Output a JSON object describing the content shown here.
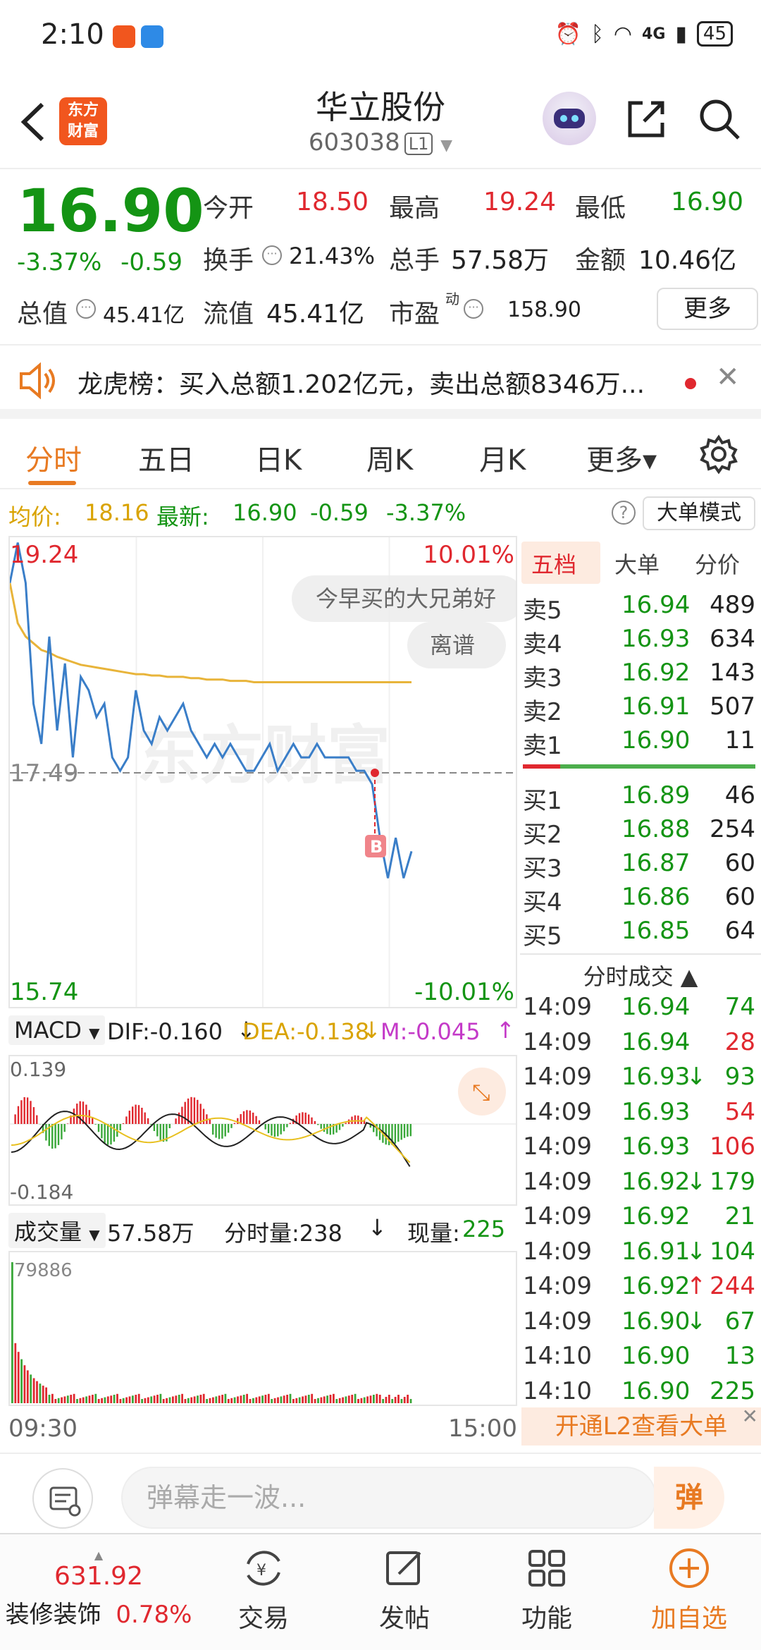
{
  "status_bar": {
    "time": "2:10",
    "battery": "45",
    "network": "4G"
  },
  "header": {
    "title": "华立股份",
    "code": "603038",
    "level": "L1"
  },
  "logo": {
    "line1": "东方",
    "line2": "财富"
  },
  "quote": {
    "price": "16.90",
    "change_pct": "-3.37%",
    "change_amt": "-0.59",
    "open_label": "今开",
    "open_value": "18.50",
    "high_label": "最高",
    "high_value": "19.24",
    "low_label": "最低",
    "low_value": "16.90",
    "turnover_rate_label": "换手",
    "turnover_rate_value": "21.43%",
    "volume_label": "总手",
    "volume_value": "57.58万",
    "amount_label": "金额",
    "amount_value": "10.46亿",
    "market_cap_label": "总值",
    "market_cap_value": "45.41亿",
    "float_cap_label": "流值",
    "float_cap_value": "45.41亿",
    "pe_label": "市盈",
    "pe_superscript": "动",
    "pe_value": "158.90",
    "more_button": "更多"
  },
  "banner": {
    "text": "龙虎榜：买入总额1.202亿元，卖出总额8346万..."
  },
  "tabs": [
    {
      "label": "分时",
      "active": true
    },
    {
      "label": "五日"
    },
    {
      "label": "日K"
    },
    {
      "label": "周K"
    },
    {
      "label": "月K"
    },
    {
      "label": "更多▾"
    }
  ],
  "avg_line": {
    "avg_label": "均价:",
    "avg_value": "18.16",
    "latest_label": "最新:",
    "latest_value": "16.90",
    "change_amt": "-0.59",
    "change_pct": "-3.37%",
    "mode_button": "大单模式"
  },
  "chart": {
    "high_label": "19.24",
    "low_label": "15.74",
    "up_pct": "10.01%",
    "down_pct": "-10.01%",
    "prev_close_label": "17.49",
    "watermark": "东方财富",
    "buy_marker": "B",
    "danmaku": [
      "今早买的大兄弟好",
      "离谱"
    ]
  },
  "chart_data": {
    "type": "line",
    "title": "",
    "ylim": [
      15.74,
      19.24
    ],
    "prev_close": 17.49,
    "series": [
      {
        "values": [
          18.9,
          19.2,
          18.9,
          18.0,
          17.7,
          18.5,
          17.8,
          18.3,
          17.6,
          18.2,
          18.1,
          17.9,
          18.0,
          17.6,
          17.5,
          17.6,
          18.1,
          17.8,
          17.7,
          17.9,
          17.8,
          17.9,
          18.0,
          17.8,
          17.7,
          17.6,
          17.7,
          17.6,
          17.7,
          17.6,
          17.5,
          17.5,
          17.6,
          17.7,
          17.5,
          17.6,
          17.7,
          17.6,
          17.6,
          17.7,
          17.6,
          17.6,
          17.6,
          17.6,
          17.5,
          17.5,
          17.4,
          17.0,
          16.7,
          17.0,
          16.7,
          16.9
        ]
      },
      {
        "name": "均价",
        "values": [
          18.9,
          18.6,
          18.5,
          18.45,
          18.4,
          18.38,
          18.35,
          18.33,
          18.31,
          18.29,
          18.28,
          18.27,
          18.26,
          18.25,
          18.24,
          18.23,
          18.22,
          18.22,
          18.21,
          18.21,
          18.2,
          18.2,
          18.2,
          18.19,
          18.19,
          18.18,
          18.18,
          18.18,
          18.17,
          18.17,
          18.17,
          18.16,
          18.16,
          18.16,
          18.16,
          18.16,
          18.16,
          18.16,
          18.16,
          18.16,
          18.16,
          18.16,
          18.16,
          18.16,
          18.16,
          18.16,
          18.16,
          18.16,
          18.16,
          18.16,
          18.16,
          18.16
        ]
      }
    ]
  },
  "macd": {
    "selector": "MACD",
    "dif": "DIF:-0.160",
    "dea": "DEA:-0.138",
    "m": "M:-0.045",
    "top_label": "0.139",
    "bottom_label": "-0.184"
  },
  "volume": {
    "selector": "成交量",
    "total": "57.58万",
    "minute_label": "分时量:238",
    "current_label": "现量:",
    "current_value": "225",
    "max_label": "79886"
  },
  "time_axis": {
    "start": "09:30",
    "end": "15:00"
  },
  "orderbook": {
    "tabs": [
      "五档",
      "大单",
      "分价"
    ],
    "asks": [
      {
        "label": "卖5",
        "price": "16.94",
        "vol": "489"
      },
      {
        "label": "卖4",
        "price": "16.93",
        "vol": "634"
      },
      {
        "label": "卖3",
        "price": "16.92",
        "vol": "143"
      },
      {
        "label": "卖2",
        "price": "16.91",
        "vol": "507"
      },
      {
        "label": "卖1",
        "price": "16.90",
        "vol": "11"
      }
    ],
    "bids": [
      {
        "label": "买1",
        "price": "16.89",
        "vol": "46"
      },
      {
        "label": "买2",
        "price": "16.88",
        "vol": "254"
      },
      {
        "label": "买3",
        "price": "16.87",
        "vol": "60"
      },
      {
        "label": "买4",
        "price": "16.86",
        "vol": "60"
      },
      {
        "label": "买5",
        "price": "16.85",
        "vol": "64"
      }
    ],
    "ticks_title": "分时成交 ▲",
    "ticks": [
      {
        "time": "14:09",
        "price": "16.94",
        "arrow": "",
        "vol": "74",
        "dir": "green"
      },
      {
        "time": "14:09",
        "price": "16.94",
        "arrow": "",
        "vol": "28",
        "dir": "red"
      },
      {
        "time": "14:09",
        "price": "16.93",
        "arrow": "↓",
        "vol": "93",
        "dir": "green"
      },
      {
        "time": "14:09",
        "price": "16.93",
        "arrow": "",
        "vol": "54",
        "dir": "red"
      },
      {
        "time": "14:09",
        "price": "16.93",
        "arrow": "",
        "vol": "106",
        "dir": "red"
      },
      {
        "time": "14:09",
        "price": "16.92",
        "arrow": "↓",
        "vol": "179",
        "dir": "green"
      },
      {
        "time": "14:09",
        "price": "16.92",
        "arrow": "",
        "vol": "21",
        "dir": "green"
      },
      {
        "time": "14:09",
        "price": "16.91",
        "arrow": "↓",
        "vol": "104",
        "dir": "green"
      },
      {
        "time": "14:09",
        "price": "16.92",
        "arrow": "↑",
        "vol": "244",
        "dir": "red"
      },
      {
        "time": "14:09",
        "price": "16.90",
        "arrow": "↓",
        "vol": "67",
        "dir": "green"
      },
      {
        "time": "14:10",
        "price": "16.90",
        "arrow": "",
        "vol": "13",
        "dir": "green"
      },
      {
        "time": "14:10",
        "price": "16.90",
        "arrow": "",
        "vol": "225",
        "dir": "green"
      }
    ],
    "l2_banner": "开通L2查看大单"
  },
  "danmaku_bar": {
    "placeholder": "弹幕走一波...",
    "send": "弹"
  },
  "bottom_nav": {
    "index_value": "631.92",
    "index_name": "装修装饰",
    "index_pct": "0.78%",
    "items": [
      "交易",
      "发帖",
      "功能",
      "加自选"
    ]
  },
  "colors": {
    "up": "#e0282f",
    "down": "#149414",
    "accent": "#e87a22",
    "avg": "#e8b43a"
  }
}
